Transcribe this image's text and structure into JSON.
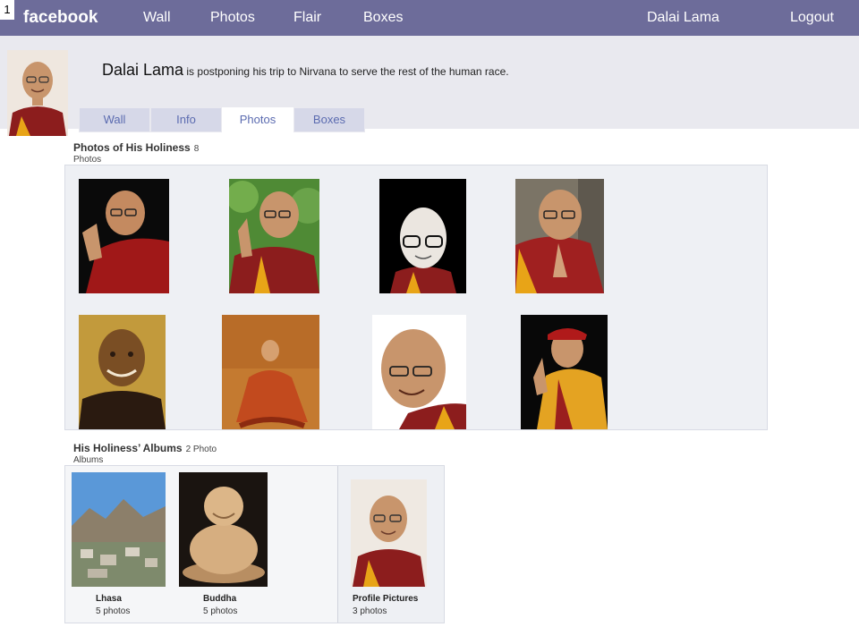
{
  "slide_number": "1",
  "topbar": {
    "logo": "facebook",
    "nav": [
      "Wall",
      "Photos",
      "Flair",
      "Boxes"
    ],
    "user": "Dalai Lama",
    "logout": "Logout"
  },
  "profile": {
    "name": "Dalai Lama",
    "status": "is postponing his trip to Nirvana to serve the rest of the human race."
  },
  "tabs": [
    "Wall",
    "Info",
    "Photos",
    "Boxes"
  ],
  "active_tab": "Photos",
  "photos_section": {
    "title": "Photos of His Holiness",
    "count": "8",
    "subtitle": "Photos"
  },
  "albums_section": {
    "title": "His Holiness’ Albums",
    "count": "2 Photo",
    "subtitle": "Albums",
    "albums": [
      {
        "name": "Lhasa",
        "count": "5 photos"
      },
      {
        "name": "Buddha",
        "count": "5 photos"
      },
      {
        "name": "Profile Pictures",
        "count": "3 photos"
      }
    ]
  },
  "colors": {
    "topbar": "#6d6c9a",
    "header_band": "#e9e9ef",
    "tab_inactive": "#d6d8e8",
    "tab_text": "#5b6bb0",
    "robe_red": "#8c1d1d",
    "robe_yellow": "#e8a417"
  }
}
